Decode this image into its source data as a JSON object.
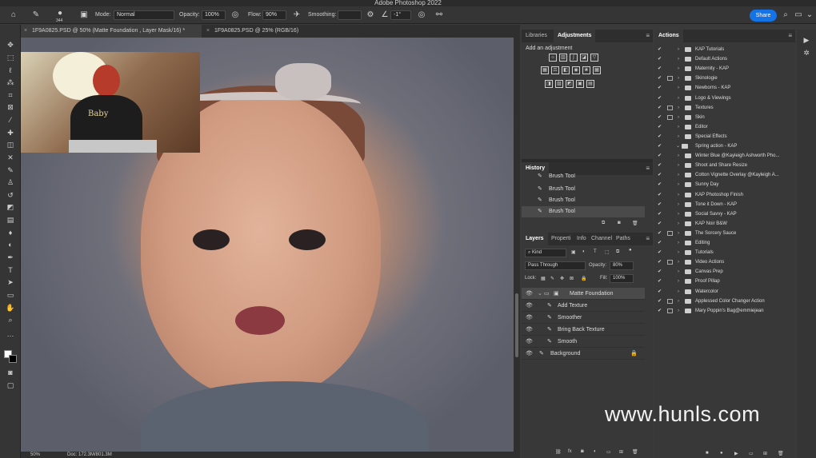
{
  "app": {
    "title": "Adobe Photoshop 2022"
  },
  "options_bar": {
    "brush_size": "344",
    "mode_label": "Mode:",
    "mode_value": "Normal",
    "opacity_label": "Opacity:",
    "opacity_value": "100%",
    "flow_label": "Flow:",
    "flow_value": "90%",
    "smoothing_label": "Smoothing:",
    "angle_value": "-1°",
    "share_label": "Share"
  },
  "tabs": [
    {
      "label": "1F9A0825.PSD @ 50% (Matte Foundation , Layer Mask/16) *",
      "active": true
    },
    {
      "label": "1F9A0825.PSD @ 25% (RGB/16)",
      "active": false
    }
  ],
  "status": {
    "zoom": "50%",
    "doc": "Doc: 172.3M/801.3M"
  },
  "adjustments_panel": {
    "tabs": [
      "Libraries",
      "Adjustments"
    ],
    "add_label": "Add an adjustment"
  },
  "history_panel": {
    "title": "History",
    "items": [
      "Brush Tool",
      "Brush Tool",
      "Brush Tool",
      "Brush Tool"
    ]
  },
  "layers_panel": {
    "tabs": [
      "Layers",
      "Properti",
      "Info",
      "Channel",
      "Paths"
    ],
    "filter_kind": "Kind",
    "blend_mode": "Pass Through",
    "opacity_label": "Opacity:",
    "opacity_value": "80%",
    "lock_label": "Lock:",
    "fill_label": "Fill:",
    "fill_value": "100%",
    "layers": [
      {
        "name": "Matte Foundation",
        "type": "group",
        "selected": true
      },
      {
        "name": "Add Texture",
        "type": "child"
      },
      {
        "name": "Smoother",
        "type": "child"
      },
      {
        "name": "Bring Back Texture",
        "type": "child"
      },
      {
        "name": "Smooth",
        "type": "child"
      },
      {
        "name": "Background",
        "type": "base",
        "locked": true
      }
    ]
  },
  "actions_panel": {
    "title": "Actions",
    "items": [
      {
        "name": "KAP Tutorials",
        "dialog": false
      },
      {
        "name": "Default Actions",
        "dialog": false
      },
      {
        "name": "Maternity - KAP",
        "dialog": false
      },
      {
        "name": "Skinologie",
        "dialog": true
      },
      {
        "name": "Newborns - KAP",
        "dialog": false
      },
      {
        "name": "Logo & Viewings",
        "dialog": false
      },
      {
        "name": "Textures",
        "dialog": true
      },
      {
        "name": "Skin",
        "dialog": true
      },
      {
        "name": "Editor",
        "dialog": false
      },
      {
        "name": "Special Effects",
        "dialog": false
      },
      {
        "name": "Spring action - KAP",
        "dialog": false,
        "open": true
      },
      {
        "name": "Winter Blue @Kayleigh Ashworth Pho...",
        "dialog": false
      },
      {
        "name": "Shoot and Share Resize",
        "dialog": false
      },
      {
        "name": "Cotton Vignette Overlay @Kayleigh A...",
        "dialog": false
      },
      {
        "name": "Sunny Day",
        "dialog": false
      },
      {
        "name": "KAP Photoshop Finish",
        "dialog": false
      },
      {
        "name": "Tone it Down - KAP",
        "dialog": false
      },
      {
        "name": "Social Savvy - KAP",
        "dialog": false
      },
      {
        "name": "KAP Noir B&W",
        "dialog": false
      },
      {
        "name": "The Sorcery Sauce",
        "dialog": true
      },
      {
        "name": "Editing",
        "dialog": false
      },
      {
        "name": "Tutorials",
        "dialog": false
      },
      {
        "name": "Video Actions",
        "dialog": true
      },
      {
        "name": "Canvas Prep",
        "dialog": false
      },
      {
        "name": "Proof Pillap",
        "dialog": false
      },
      {
        "name": "Watercolor",
        "dialog": false
      },
      {
        "name": "Applessed Color Changer Action",
        "dialog": true
      },
      {
        "name": "Mary Poppin's Bag@emmiejean",
        "dialog": true
      }
    ]
  },
  "webcam": {
    "shirt_text": "Baby"
  },
  "watermark": "www.hunls.com"
}
